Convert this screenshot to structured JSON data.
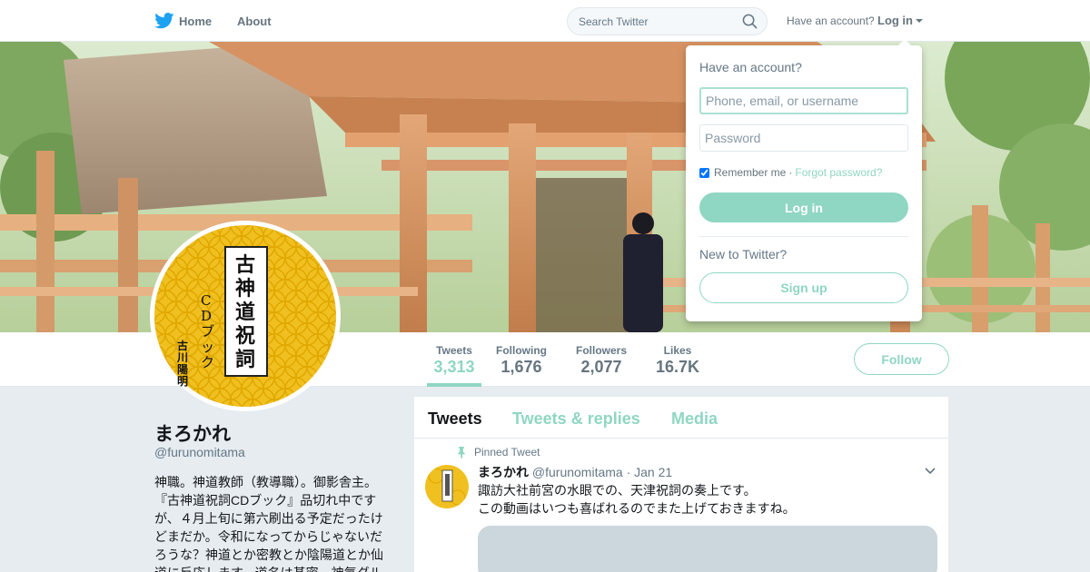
{
  "nav": {
    "home_label": "Home",
    "about_label": "About",
    "search_placeholder": "Search Twitter",
    "have_account": "Have an account?",
    "login_label": "Log in"
  },
  "login_dropdown": {
    "title": "Have an account?",
    "username_placeholder": "Phone, email, or username",
    "password_placeholder": "Password",
    "remember_me": "Remember me",
    "separator": "·",
    "forgot_password": "Forgot password?",
    "login_button": "Log in",
    "new_to_twitter": "New to Twitter?",
    "signup_button": "Sign up"
  },
  "stats": [
    {
      "label": "Tweets",
      "value": "3,313"
    },
    {
      "label": "Following",
      "value": "1,676"
    },
    {
      "label": "Followers",
      "value": "2,077"
    },
    {
      "label": "Likes",
      "value": "16.7K"
    }
  ],
  "follow_button": "Follow",
  "profile": {
    "name": "まろかれ",
    "handle": "@furunomitama",
    "bio": "神職。神道教師（教導職）。御影舎主。『古神道祝詞CDブック』品切れ中ですが、４月上旬に第六刷出る予定だったけどまだか。令和になってからじゃないだろうな？神道とか密教とか陰陽道とか仙道に反応します。道名は基密。神氣ダル"
  },
  "avatar": {
    "title_text": "古神道祝詞",
    "subtitle_text": "CDブック",
    "author_text": "古川陽明",
    "colors": {
      "gold": "#f0c020",
      "pattern": "#e0a800"
    }
  },
  "timeline": {
    "tabs": [
      "Tweets",
      "Tweets & replies",
      "Media"
    ],
    "pinned_label": "Pinned Tweet",
    "tweet": {
      "name": "まろかれ",
      "handle": "@furunomitama",
      "date": "· Jan 21",
      "line1": "諏訪大社前宮の水眼での、天津祝詞の奏上です。",
      "line2": "この動画はいつも喜ばれるのでまた上げておきますね。"
    }
  },
  "colors": {
    "accent": "#8fd6c3",
    "twitter_blue": "#1da1f2",
    "background": "#e6ecf0"
  }
}
